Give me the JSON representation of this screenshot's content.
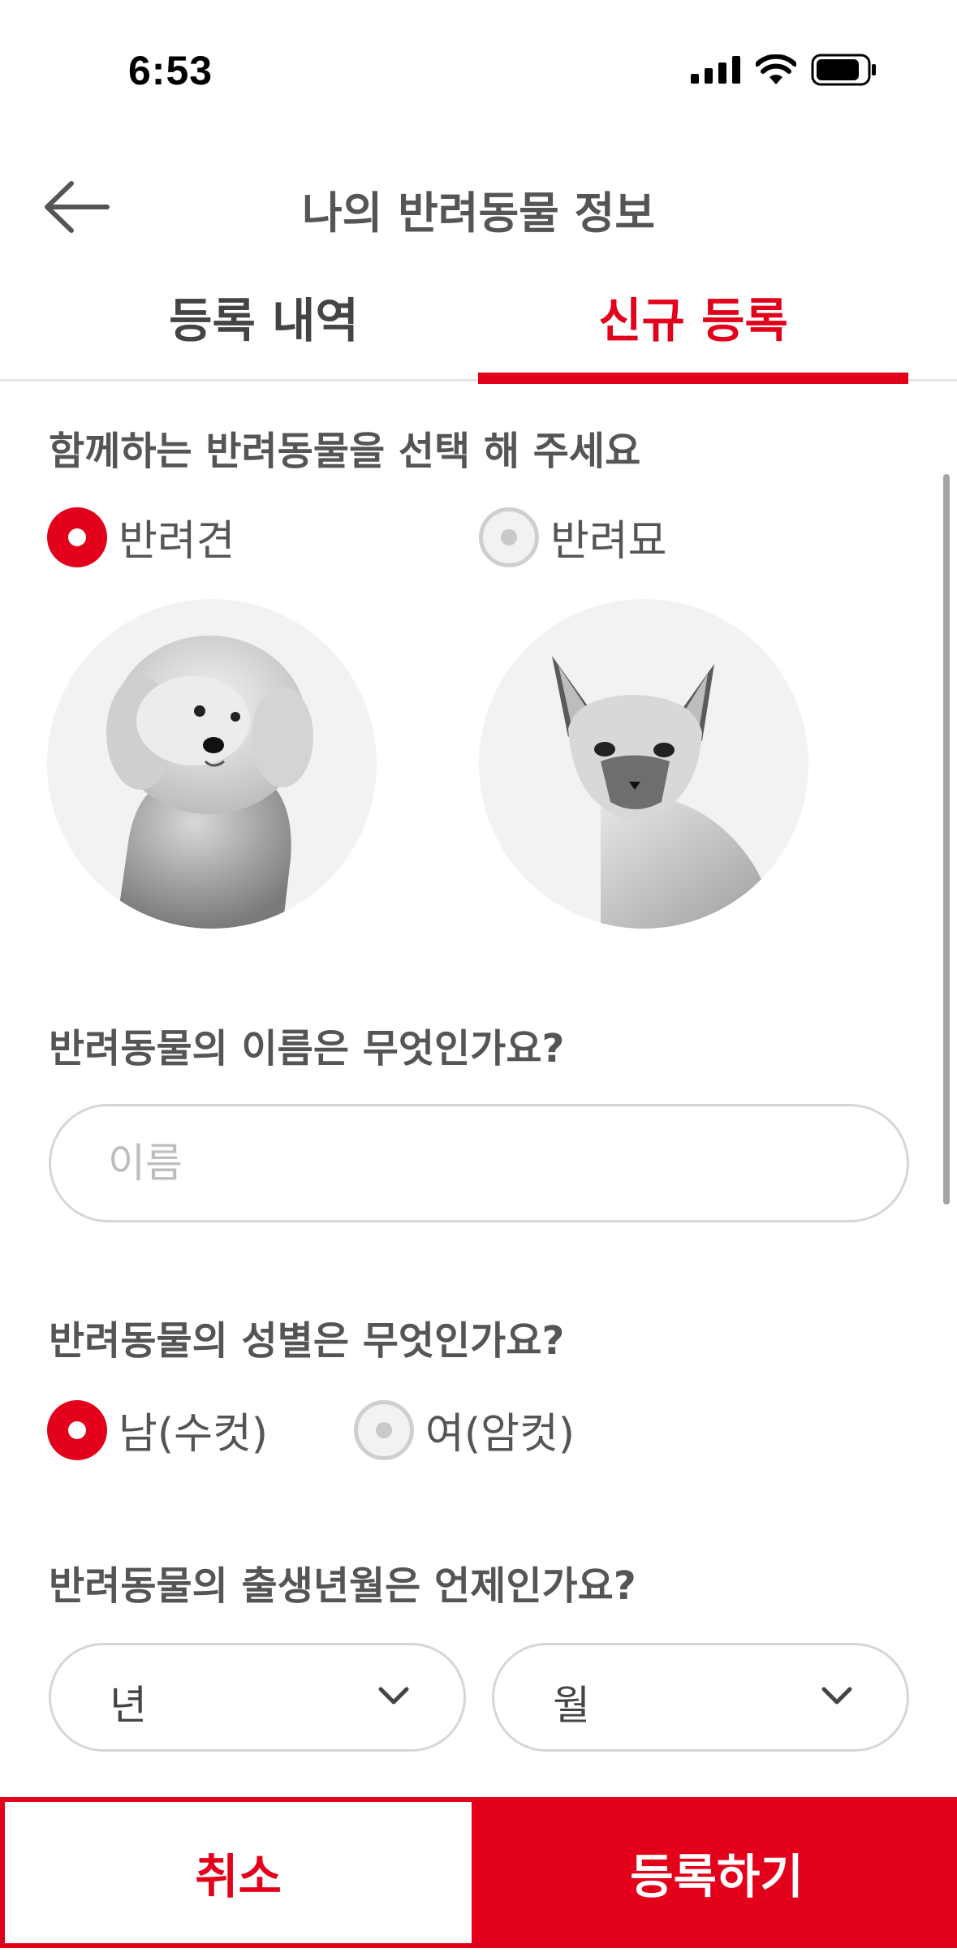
{
  "status": {
    "time": "6:53"
  },
  "header": {
    "title": "나의 반려동물 정보"
  },
  "tabs": [
    {
      "label": "등록 내역",
      "active": false
    },
    {
      "label": "신규 등록",
      "active": true
    }
  ],
  "species": {
    "question": "함께하는 반려동물을 선택 해 주세요",
    "options": [
      {
        "label": "반려견",
        "selected": true
      },
      {
        "label": "반려묘",
        "selected": false
      }
    ]
  },
  "name": {
    "question": "반려동물의 이름은 무엇인가요?",
    "placeholder": "이름",
    "value": ""
  },
  "gender": {
    "question": "반려동물의 성별은 무엇인가요?",
    "options": [
      {
        "label": "남(수컷)",
        "selected": true
      },
      {
        "label": "여(암컷)",
        "selected": false
      }
    ]
  },
  "birth": {
    "question": "반려동물의 출생년월은 언제인가요?",
    "year_label": "년",
    "month_label": "월"
  },
  "footer": {
    "cancel_label": "취소",
    "submit_label": "등록하기"
  },
  "colors": {
    "accent": "#e2001a",
    "text": "#555555",
    "border": "#d6d6d6"
  }
}
